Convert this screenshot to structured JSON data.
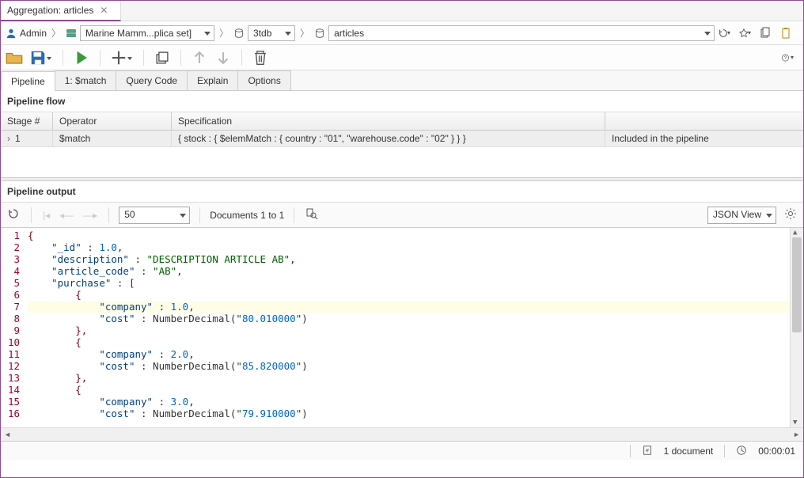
{
  "docTab": {
    "title": "Aggregation: articles"
  },
  "breadcrumb": {
    "user": "Admin",
    "replica": "Marine Mamm...plica set]",
    "db": "3tdb",
    "collection": "articles"
  },
  "subtabs": [
    "Pipeline",
    "1: $match",
    "Query Code",
    "Explain",
    "Options"
  ],
  "pipelineFlow": {
    "title": "Pipeline flow",
    "headers": {
      "stage": "Stage #",
      "operator": "Operator",
      "spec": "Specification",
      "status": ""
    },
    "rows": [
      {
        "stage": "1",
        "operator": "$match",
        "spec": "{ stock : { $elemMatch : { country : \"01\", \"warehouse.code\" : \"02\" } } }",
        "status": "Included in the pipeline"
      }
    ]
  },
  "pipelineOutput": {
    "title": "Pipeline output",
    "pageSize": "50",
    "rangeLabel": "Documents 1 to 1",
    "viewMode": "JSON View",
    "code": {
      "lines": [
        "{",
        "    \"_id\" : 1.0,",
        "    \"description\" : \"DESCRIPTION ARTICLE AB\",",
        "    \"article_code\" : \"AB\",",
        "    \"purchase\" : [",
        "        {",
        "            \"company\" : 1.0,",
        "            \"cost\" : NumberDecimal(\"80.010000\")",
        "        },",
        "        {",
        "            \"company\" : 2.0,",
        "            \"cost\" : NumberDecimal(\"85.820000\")",
        "        },",
        "        {",
        "            \"company\" : 3.0,",
        "            \"cost\" : NumberDecimal(\"79.910000\")"
      ]
    }
  },
  "status": {
    "docCount": "1 document",
    "elapsed": "00:00:01"
  }
}
